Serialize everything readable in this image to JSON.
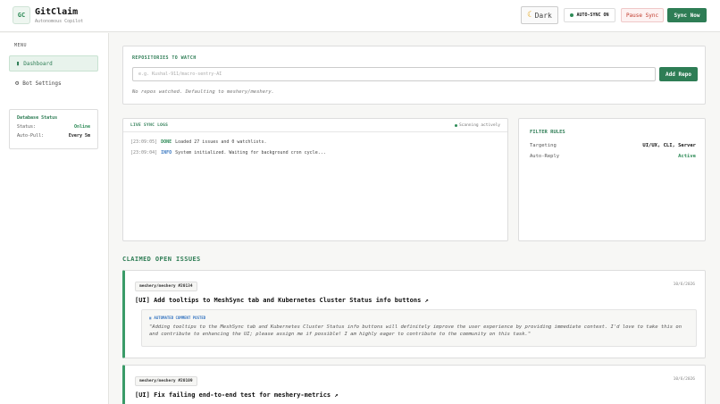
{
  "header": {
    "logo": "GC",
    "title": "GitClaim",
    "subtitle": "Autonomous Copilot",
    "theme_label": "Dark",
    "theme_icon": "☾",
    "autosync_label": "AUTO-SYNC ON",
    "pause_label": "Pause Sync",
    "syncnow_label": "Sync Now"
  },
  "sidebar": {
    "menu_label": "MENU",
    "items": [
      {
        "label": "Dashboard",
        "icon": "▮"
      },
      {
        "label": "Bot Settings",
        "icon": "⚙"
      }
    ],
    "db": {
      "title": "Database Status",
      "status_label": "Status:",
      "status_value": "Online",
      "autopull_label": "Auto-Pull:",
      "autopull_value": "Every 5m"
    }
  },
  "repos": {
    "title": "REPOSITORIES TO WATCH",
    "input_placeholder": "e.g. Kushal-911/macro-sentry-AI",
    "add_label": "Add Repo",
    "empty_text": "No repos watched. Defaulting to meshery/meshery."
  },
  "logs": {
    "title": "LIVE SYNC LOGS",
    "scanning": "Scanning actively",
    "lines": [
      {
        "time": "[23:09:05]",
        "level": "DONE",
        "text": "Loaded 27 issues and 0 watchlists."
      },
      {
        "time": "[23:09:04]",
        "level": "INFO",
        "text": "System initialized. Waiting for background cron cycle..."
      }
    ]
  },
  "filter": {
    "title": "FILTER RULES",
    "targeting_label": "Targeting",
    "targeting_value": "UI/UX, CLI, Server",
    "autoreply_label": "Auto-Reply",
    "autoreply_value": "Active"
  },
  "claimed": {
    "title": "CLAIMED OPEN ISSUES",
    "issues": [
      {
        "repo": "meshery/meshery #20134",
        "date": "10/6/2026",
        "title": "[UI] Add tooltips to MeshSync tab and Kubernetes Cluster Status info buttons ↗",
        "comment_label": "AUTOMATED COMMENT POSTED",
        "comment": "\"Adding tooltips to the MeshSync tab and Kubernetes Cluster Status info buttons will definitely improve the user experience by providing immediate context. I'd love to take this on and contribute to enhancing the UI; please assign me if possible! I am highly eager to contribute to the community on this task.\""
      },
      {
        "repo": "meshery/meshery #20109",
        "date": "10/6/2026",
        "title": "[UI] Fix failing end-to-end test for meshery-metrics ↗"
      }
    ]
  },
  "colors": {
    "accent": "#2e7d55",
    "info": "#3a78c2",
    "danger": "#c0392b"
  }
}
